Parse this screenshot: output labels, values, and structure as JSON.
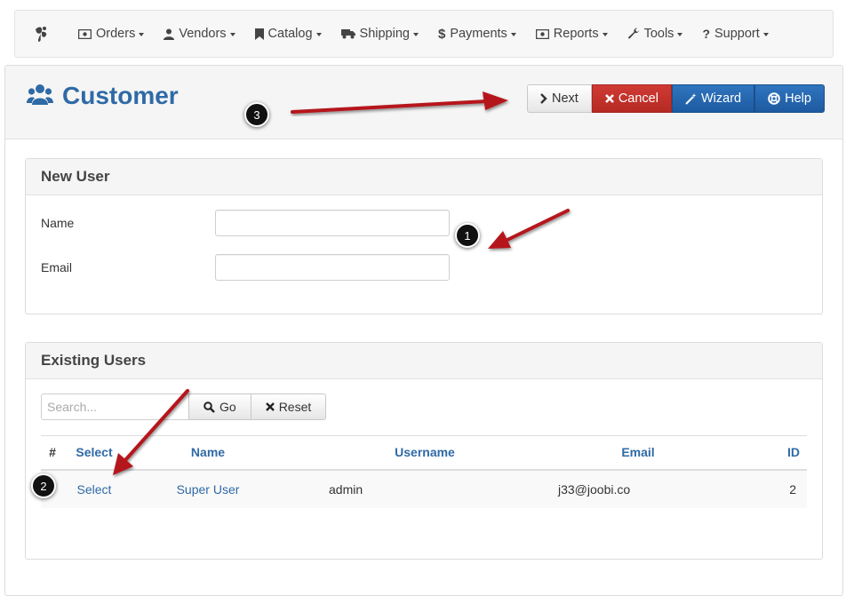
{
  "nav": {
    "items": [
      {
        "label": "Orders",
        "icon": "money-icon"
      },
      {
        "label": "Vendors",
        "icon": "user-icon"
      },
      {
        "label": "Catalog",
        "icon": "bookmark-icon"
      },
      {
        "label": "Shipping",
        "icon": "truck-icon"
      },
      {
        "label": "Payments",
        "icon": "dollar-icon"
      },
      {
        "label": "Reports",
        "icon": "money-icon"
      },
      {
        "label": "Tools",
        "icon": "wrench-icon"
      },
      {
        "label": "Support",
        "icon": "question-icon"
      }
    ]
  },
  "header": {
    "title": "Customer",
    "icon": "users-icon"
  },
  "toolbar": {
    "next_label": "Next",
    "cancel_label": "Cancel",
    "wizard_label": "Wizard",
    "help_label": "Help"
  },
  "new_user": {
    "heading": "New User",
    "name_label": "Name",
    "email_label": "Email",
    "name_value": "",
    "email_value": ""
  },
  "existing_users": {
    "heading": "Existing Users",
    "search_placeholder": "Search...",
    "go_label": "Go",
    "reset_label": "Reset",
    "columns": {
      "num": "#",
      "select": "Select",
      "name": "Name",
      "username": "Username",
      "email": "Email",
      "id": "ID"
    },
    "rows": [
      {
        "select": "Select",
        "name": "Super User",
        "username": "admin",
        "email": "j33@joobi.co",
        "id": "2"
      }
    ]
  },
  "annotations": {
    "callout_1": "1",
    "callout_2": "2",
    "callout_3": "3"
  },
  "colors": {
    "accent": "#2f6aa6",
    "cancel": "#c0312b",
    "primary": "#2365ad",
    "arrow": "#b5161b"
  }
}
